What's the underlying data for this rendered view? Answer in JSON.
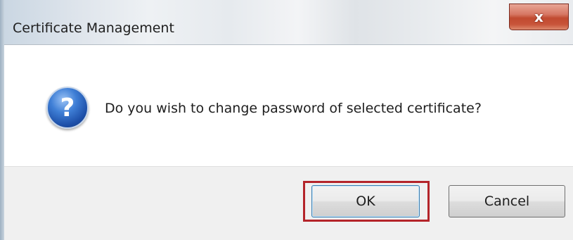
{
  "dialog": {
    "title": "Certificate Management",
    "close_label": "x",
    "icon": "question-icon",
    "icon_glyph": "?",
    "message": "Do you wish to change password of selected certificate?",
    "buttons": {
      "ok_label": "OK",
      "cancel_label": "Cancel"
    },
    "colors": {
      "highlight": "#b4242a",
      "close_button": "#c14a30",
      "icon_blue": "#1d4fa8"
    }
  }
}
